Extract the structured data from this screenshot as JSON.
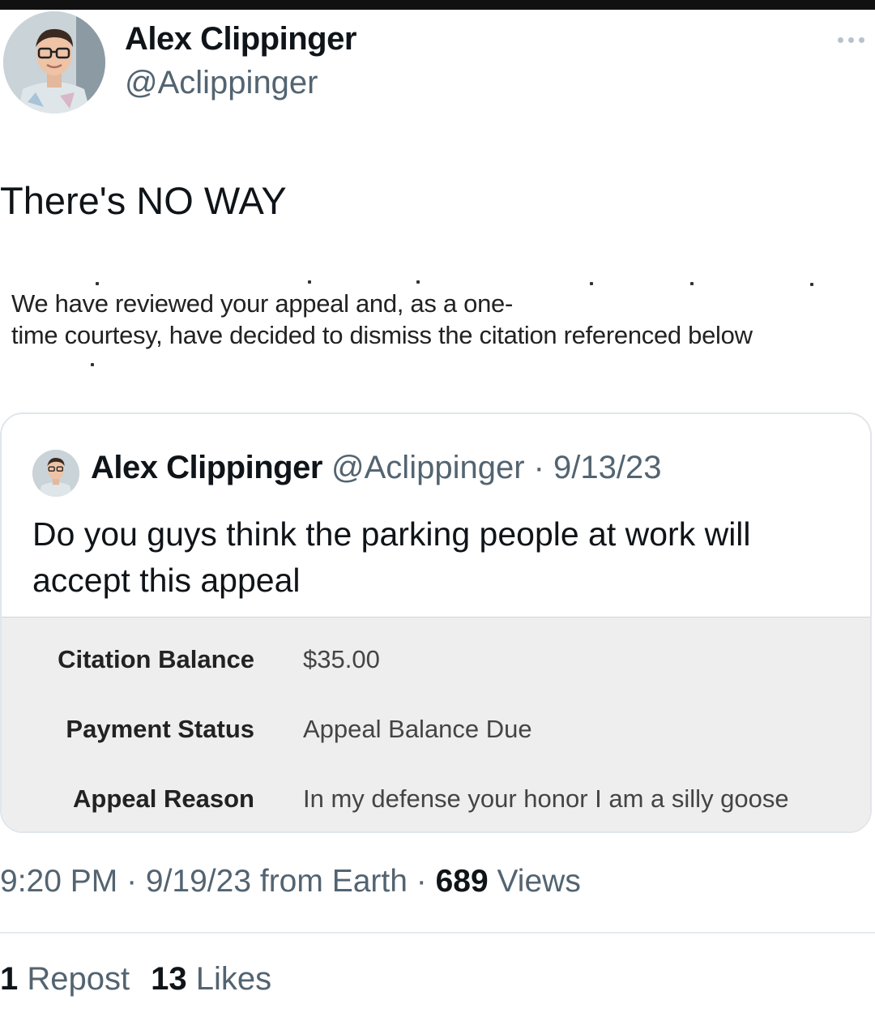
{
  "author": {
    "name": "Alex Clippinger",
    "handle": "@Aclippinger"
  },
  "tweet": {
    "text": "There's NO WAY"
  },
  "letter": {
    "line1": "We have reviewed your appeal and, as a one-",
    "line2": "time courtesy, have decided to dismiss the citation referenced below"
  },
  "quote": {
    "name": "Alex Clippinger",
    "meta": "@Aclippinger · 9/13/23",
    "text": "Do you guys think the parking people at work will accept this appeal",
    "citation": [
      {
        "label": "Citation Balance",
        "value": "$35.00"
      },
      {
        "label": "Payment Status",
        "value": "Appeal Balance Due"
      },
      {
        "label": "Appeal Reason",
        "value": "In my defense your honor I am a silly goose"
      }
    ]
  },
  "meta": {
    "time_date": "9:20 PM · 9/19/23 from Earth · ",
    "views_count": "689",
    "views_label": " Views"
  },
  "engagement": {
    "reposts_count": "1",
    "reposts_label": " Repost",
    "likes_count": "13",
    "likes_label": " Likes"
  },
  "icons": {
    "avatar": "profile-photo",
    "more": "more-horizontal-icon"
  }
}
